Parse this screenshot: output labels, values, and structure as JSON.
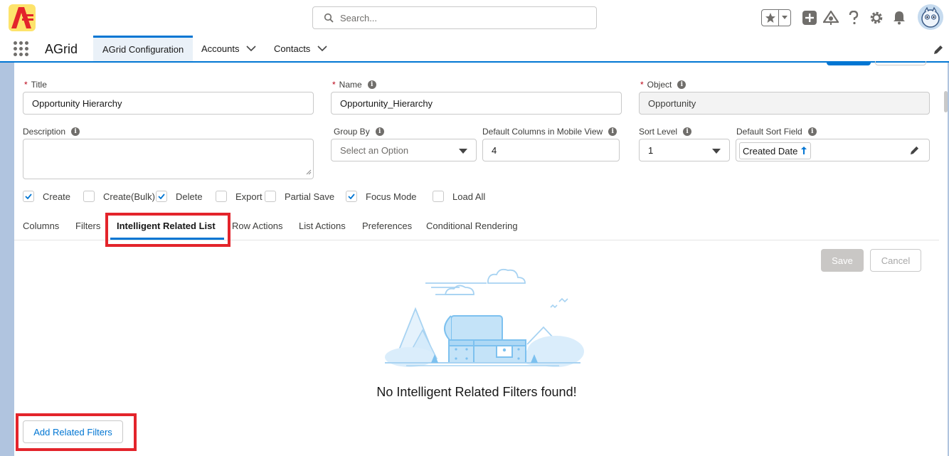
{
  "header": {
    "search_placeholder": "Search...",
    "icons": [
      "favorites-star-icon",
      "add-icon",
      "trailhead-icon",
      "help-icon",
      "setup-gear-icon",
      "notification-bell-icon"
    ]
  },
  "nav": {
    "app_name": "AGrid",
    "tabs": [
      {
        "label": "AGrid Configuration",
        "active": true
      },
      {
        "label": "Accounts",
        "has_menu": true
      },
      {
        "label": "Contacts",
        "has_menu": true
      }
    ]
  },
  "form": {
    "title": {
      "label": "Title",
      "required": true,
      "value": "Opportunity Hierarchy"
    },
    "name": {
      "label": "Name",
      "required": true,
      "value": "Opportunity_Hierarchy"
    },
    "object": {
      "label": "Object",
      "required": true,
      "value": "Opportunity",
      "disabled": true
    },
    "description": {
      "label": "Description",
      "value": ""
    },
    "group_by": {
      "label": "Group By",
      "placeholder": "Select an Option"
    },
    "mobile_columns": {
      "label": "Default Columns in Mobile View",
      "value": "4"
    },
    "sort_level": {
      "label": "Sort Level",
      "value": "1"
    },
    "sort_field": {
      "label": "Default Sort Field",
      "value": "Created Date"
    }
  },
  "checkboxes": [
    {
      "label": "Create",
      "checked": true
    },
    {
      "label": "Create(Bulk)",
      "checked": false
    },
    {
      "label": "Delete",
      "checked": true
    },
    {
      "label": "Export",
      "checked": false
    },
    {
      "label": "Partial Save",
      "checked": false
    },
    {
      "label": "Focus Mode",
      "checked": true
    },
    {
      "label": "Load All",
      "checked": false
    }
  ],
  "tabs": [
    {
      "label": "Columns"
    },
    {
      "label": "Filters"
    },
    {
      "label": "Intelligent Related List",
      "active": true
    },
    {
      "label": "Row Actions"
    },
    {
      "label": "List Actions"
    },
    {
      "label": "Preferences"
    },
    {
      "label": "Conditional Rendering"
    }
  ],
  "actions": {
    "save": "Save",
    "cancel": "Cancel",
    "add_related": "Add Related Filters"
  },
  "empty_state": {
    "message": "No Intelligent Related Filters found!"
  },
  "colors": {
    "brand": "#0176d3",
    "highlight": "#e3242b",
    "required": "#ba0517"
  }
}
